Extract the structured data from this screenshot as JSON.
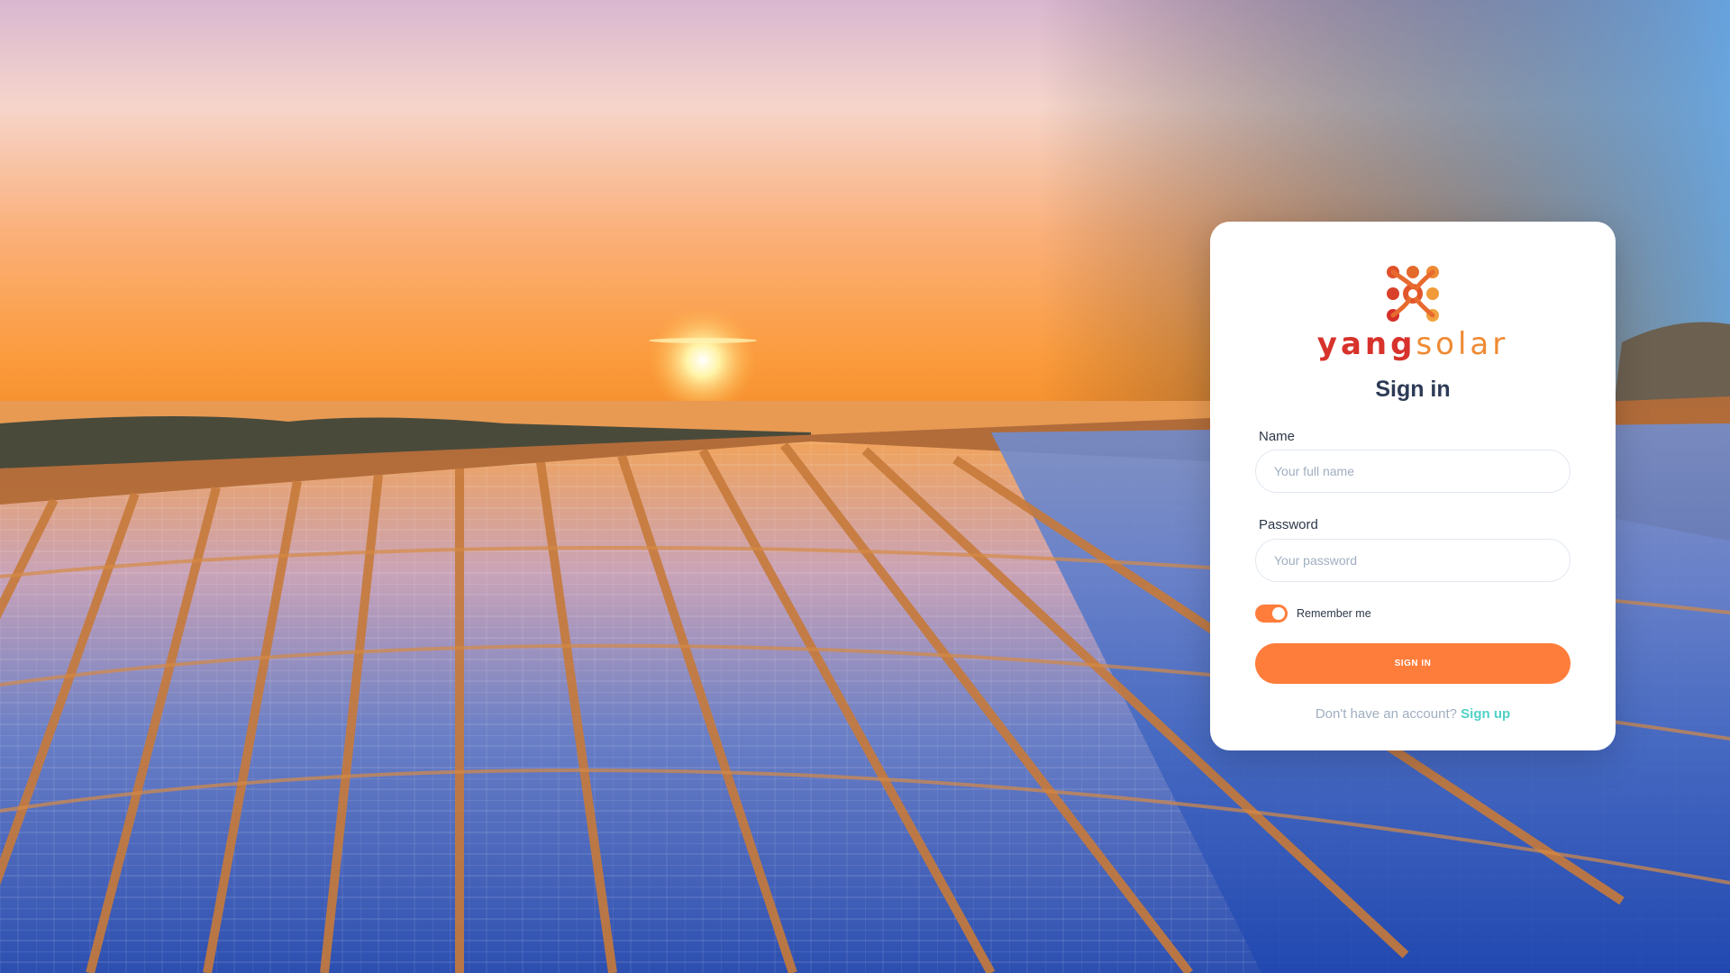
{
  "brand": {
    "part1": "yang",
    "part2": "solar"
  },
  "form": {
    "title": "Sign in",
    "name_label": "Name",
    "name_placeholder": "Your full name",
    "password_label": "Password",
    "password_placeholder": "Your password",
    "remember_label": "Remember me",
    "remember_checked": true,
    "submit_label": "SIGN IN",
    "footer_text": "Don't have an account?",
    "signup_link": "Sign up"
  },
  "colors": {
    "accent": "#ff7d3b",
    "link": "#4fd1c5",
    "title": "#2d3b56",
    "brand_red": "#d7322b",
    "brand_orange": "#ef8a33"
  }
}
